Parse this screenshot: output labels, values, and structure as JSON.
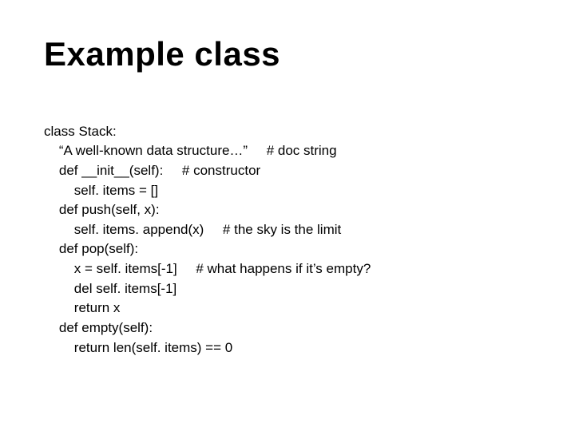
{
  "title": "Example class",
  "code": {
    "lines": [
      "class Stack:",
      "    “A well-known data structure…”     # doc string",
      "    def __init__(self):     # constructor",
      "        self. items = []",
      "    def push(self, x):",
      "        self. items. append(x)     # the sky is the limit",
      "    def pop(self):",
      "        x = self. items[-1]     # what happens if it’s empty?",
      "        del self. items[-1]",
      "        return x",
      "    def empty(self):",
      "        return len(self. items) == 0"
    ]
  }
}
